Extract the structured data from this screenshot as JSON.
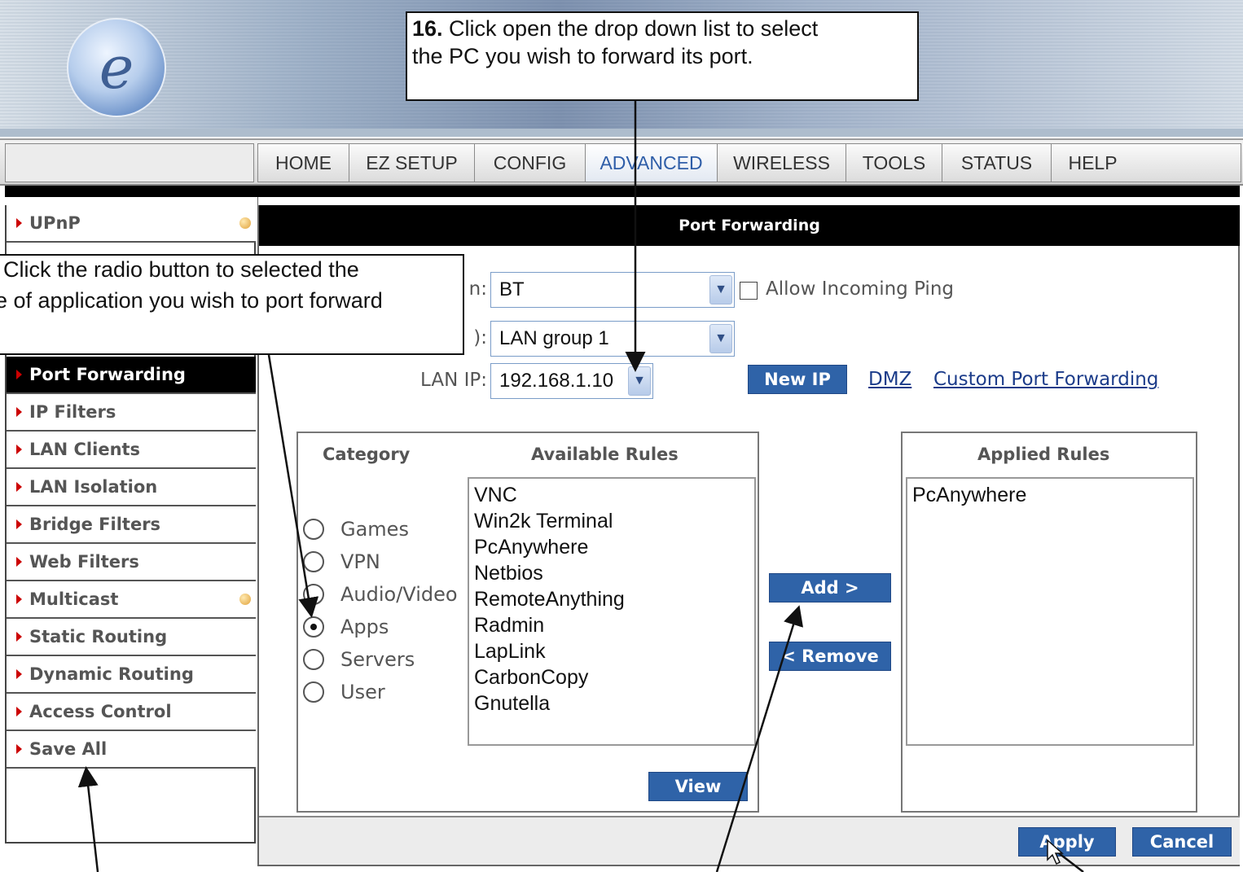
{
  "banner": {
    "logo_letter": "e"
  },
  "nav": {
    "tabs": [
      "HOME",
      "EZ SETUP",
      "CONFIG",
      "ADVANCED",
      "WIRELESS",
      "TOOLS",
      "STATUS",
      "HELP"
    ],
    "active_tab": "ADVANCED"
  },
  "sidebar": {
    "items": [
      {
        "label": "UPnP"
      },
      {
        "label": "Port Forwarding"
      },
      {
        "label": "IP Filters"
      },
      {
        "label": "LAN Clients"
      },
      {
        "label": "LAN Isolation"
      },
      {
        "label": "Bridge Filters"
      },
      {
        "label": "Web Filters"
      },
      {
        "label": "Multicast"
      },
      {
        "label": "Static Routing"
      },
      {
        "label": "Dynamic Routing"
      },
      {
        "label": "Access Control"
      },
      {
        "label": "Save All"
      }
    ],
    "active_item": "Port Forwarding"
  },
  "main": {
    "title": "Port Forwarding",
    "connection_label_partial": "n:",
    "connection_value": "BT",
    "allow_ping_label": "Allow Incoming Ping",
    "lan_group_label_partial": "):",
    "lan_group_value": "LAN group 1",
    "lan_ip_label": "LAN IP:",
    "lan_ip_value": "192.168.1.10",
    "new_ip_button": "New IP",
    "dmz_link": "DMZ",
    "custom_link": "Custom Port Forwarding",
    "category_header": "Category",
    "available_header": "Available Rules",
    "applied_header": "Applied Rules",
    "categories": [
      {
        "label": "Games",
        "checked": false
      },
      {
        "label": "VPN",
        "checked": false
      },
      {
        "label": "Audio/Video",
        "checked": false
      },
      {
        "label": "Apps",
        "checked": true
      },
      {
        "label": "Servers",
        "checked": false
      },
      {
        "label": "User",
        "checked": false
      }
    ],
    "available_rules": [
      "VNC",
      "Win2k Terminal",
      "PcAnywhere",
      "Netbios",
      "RemoteAnything",
      "Radmin",
      "LapLink",
      "CarbonCopy",
      "Gnutella"
    ],
    "applied_rules": [
      "PcAnywhere"
    ],
    "add_button": "Add >",
    "remove_button": "< Remove",
    "view_button": "View",
    "apply_button": "Apply",
    "cancel_button": "Cancel"
  },
  "callouts": {
    "step16_number": "16.",
    "step16_line1_rest": " Click open the drop down list to select",
    "step16_line2": "the PC you wish to forward its port.",
    "radio_line1": "Click the radio button to selected the",
    "radio_line2": "e of application you wish to port forward"
  }
}
